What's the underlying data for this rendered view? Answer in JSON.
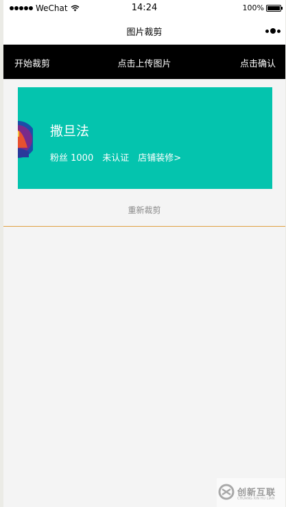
{
  "status_bar": {
    "carrier": "WeChat",
    "time": "14:24",
    "battery": "100%",
    "signal_icon": "signal-dots-icon",
    "wifi_icon": "wifi-icon",
    "battery_icon": "battery-icon"
  },
  "nav": {
    "title": "图片裁剪",
    "more_icon": "more-icon"
  },
  "toolbar": {
    "start_crop": "开始裁剪",
    "upload": "点击上传图片",
    "confirm": "点击确认"
  },
  "banner": {
    "background_color": "#04c4ae",
    "shop_name": "撒旦法",
    "fans": "粉丝 1000",
    "verified": "未认证",
    "decorate_link": "店铺装修>"
  },
  "recrop_label": "重新裁剪",
  "divider_color": "#e0a040",
  "watermark": {
    "text": "创新互联",
    "sub": "CHUANG XIN HU LIAN"
  }
}
